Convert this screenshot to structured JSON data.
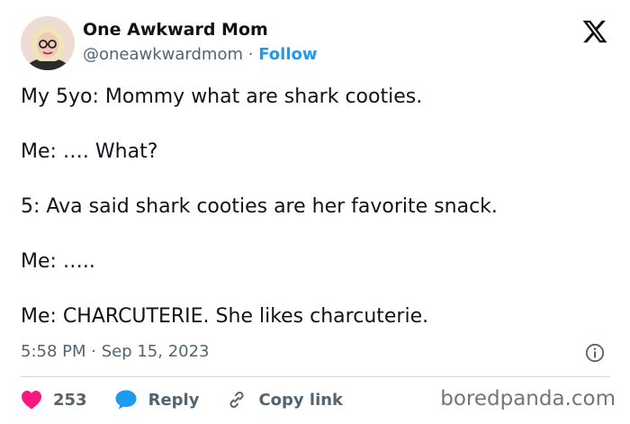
{
  "author": {
    "name": "One Awkward Mom",
    "handle": "@oneawkwardmom",
    "separator": "·",
    "follow_label": "Follow"
  },
  "tweet": {
    "lines": [
      "My 5yo: Mommy what are shark cooties.",
      "Me: …. What?",
      "5: Ava said shark cooties are her favorite snack.",
      "Me: …..",
      "Me: CHARCUTERIE. She likes charcuterie."
    ],
    "timestamp": "5:58 PM · Sep 15, 2023"
  },
  "actions": {
    "like_count": "253",
    "reply_label": "Reply",
    "copy_link_label": "Copy link"
  },
  "watermark": "boredpanda.com",
  "icons": {
    "like": "heart-icon",
    "reply": "speech-bubble-icon",
    "copy": "link-icon",
    "info": "info-icon",
    "brand": "x-logo-icon"
  },
  "colors": {
    "text": "#0f1419",
    "muted": "#536471",
    "follow": "#1d9bf0",
    "like": "#f91880",
    "reply": "#1d9bf0"
  }
}
